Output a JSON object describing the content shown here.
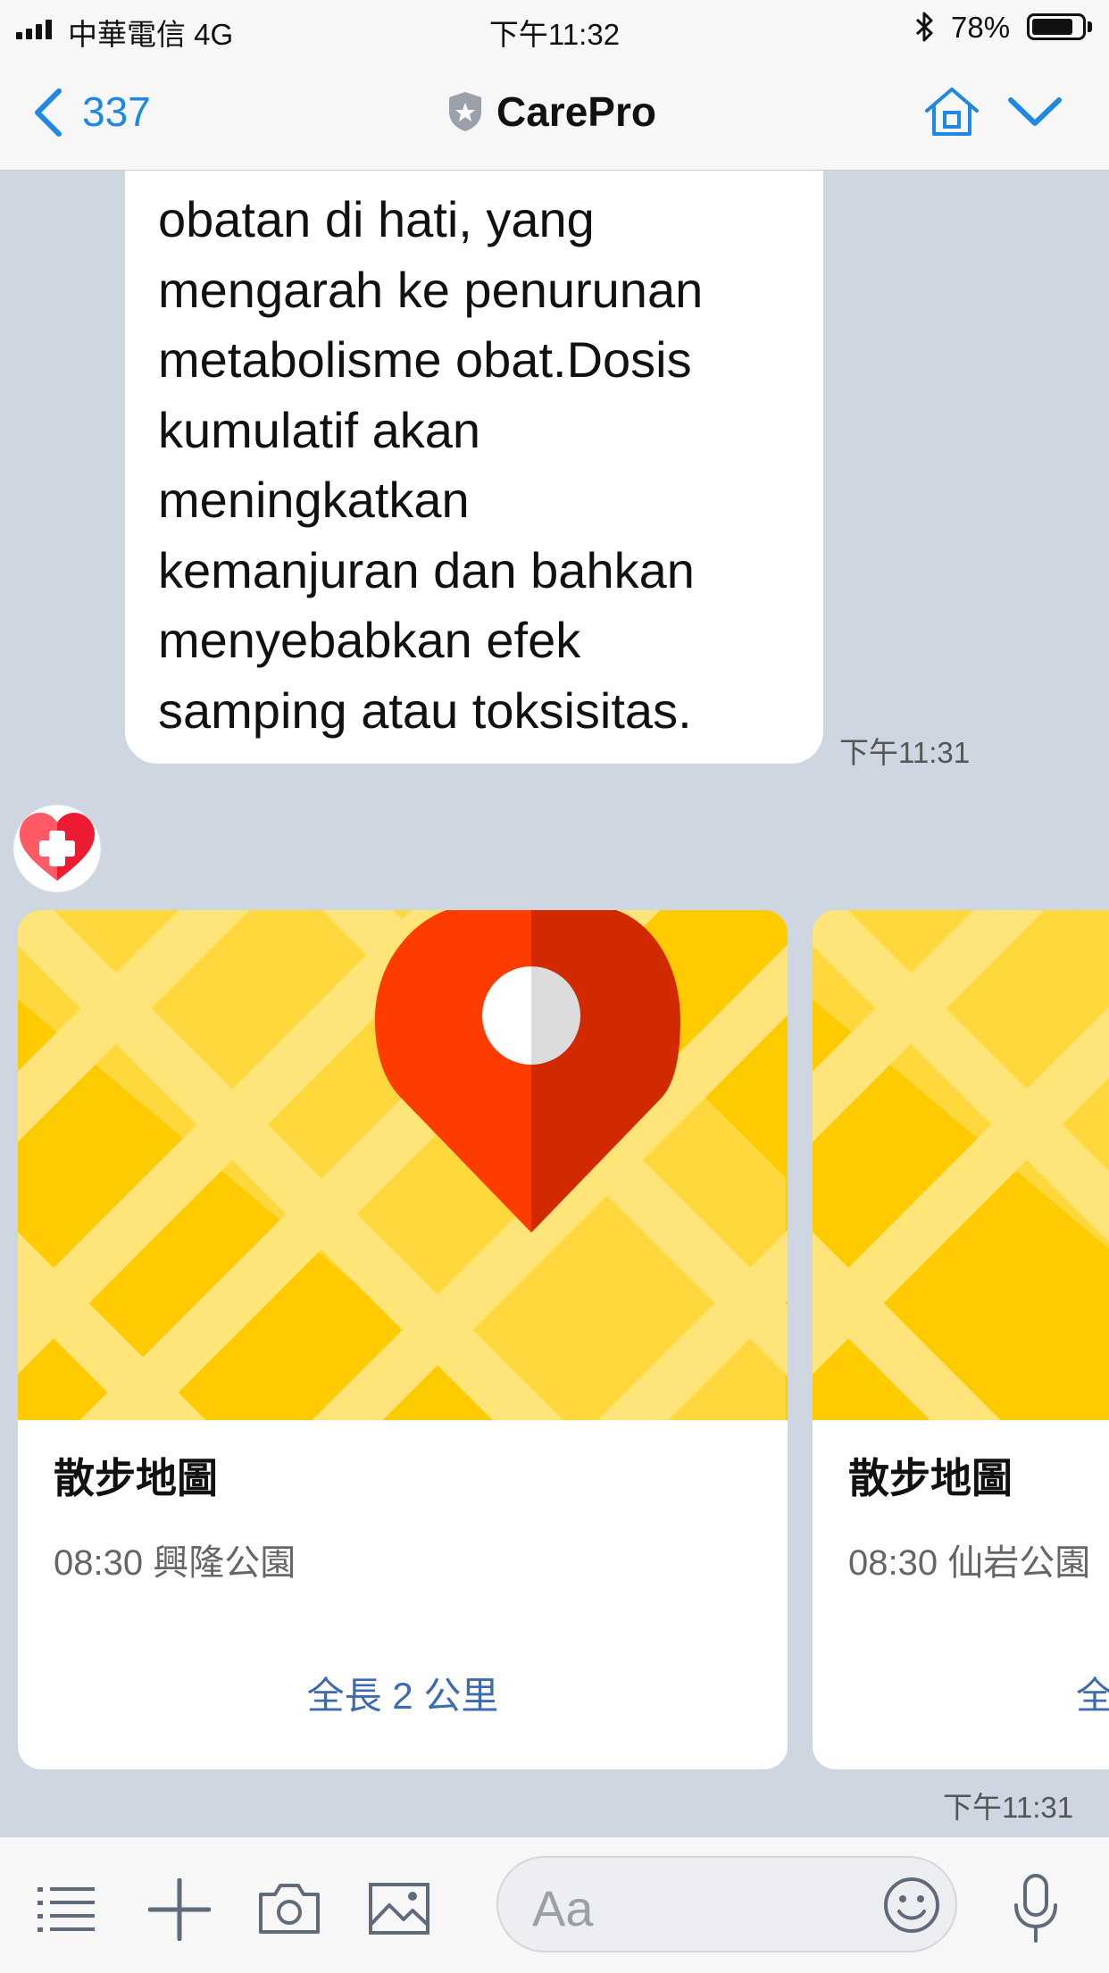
{
  "status_bar": {
    "carrier": "中華電信   4G",
    "time": "下午11:32",
    "battery": "78%",
    "battery_level": 0.78
  },
  "nav": {
    "back_count": "337",
    "title": "CarePro"
  },
  "messages": {
    "bubble_text": "metabolisme obat\nobatan di hati, yang\nmengarah ke penurunan\nmetabolisme obat.Dosis\nkumulatif akan\nmeningkatkan\nkemanjuran dan bahkan\nmenyebabkan efek\nsamping atau toksisitas.",
    "bubble_time": "下午11:31",
    "cards_time": "下午11:31"
  },
  "cards": [
    {
      "title": "散步地圖",
      "subtitle": "08:30 興隆公園",
      "footer": "全長 2 公里"
    },
    {
      "title": "散步地圖",
      "subtitle": "08:30 仙岩公園",
      "footer": "全長"
    }
  ],
  "input": {
    "placeholder": "Aa"
  },
  "colors": {
    "accent": "#1e88e5",
    "chat_bg": "#cdd6e1",
    "map_yellow": "#fecb00",
    "pin_red": "#ff3c00"
  }
}
